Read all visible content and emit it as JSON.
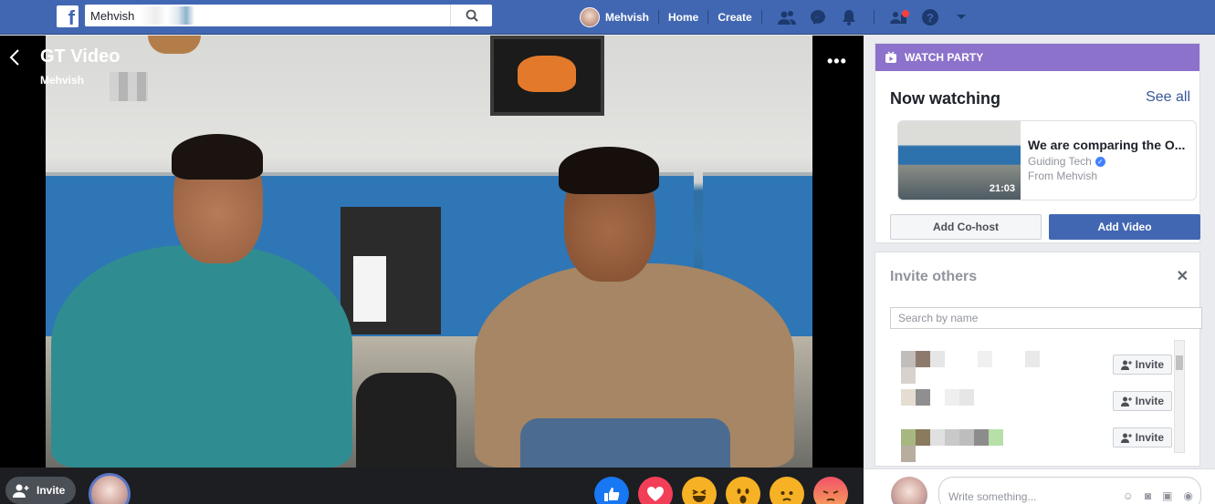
{
  "topbar": {
    "search_value": "Mehvish",
    "user_name": "Mehvish",
    "home_label": "Home",
    "create_label": "Create"
  },
  "video": {
    "title": "GT Video",
    "owner": "Mehvish"
  },
  "bottom_bar": {
    "invite_label": "Invite",
    "reactions": [
      "like-reaction",
      "love-reaction",
      "haha-reaction",
      "wow-reaction",
      "sad-reaction",
      "angry-reaction"
    ]
  },
  "watch_party": {
    "header": "WATCH PARTY",
    "now_watching": "Now watching",
    "see_all": "See all",
    "video_title": "We are comparing the O...",
    "video_source": "Guiding Tech",
    "video_from": "From Mehvish",
    "duration": "21:03",
    "add_cohost": "Add Co-host",
    "add_video": "Add Video"
  },
  "invite_others": {
    "title": "Invite others",
    "search_placeholder": "Search by name",
    "invite_label": "Invite"
  },
  "composer": {
    "placeholder": "Write something..."
  },
  "colors": {
    "brand": "#4267b2",
    "watch_party": "#8c72cb",
    "link": "#365899"
  }
}
